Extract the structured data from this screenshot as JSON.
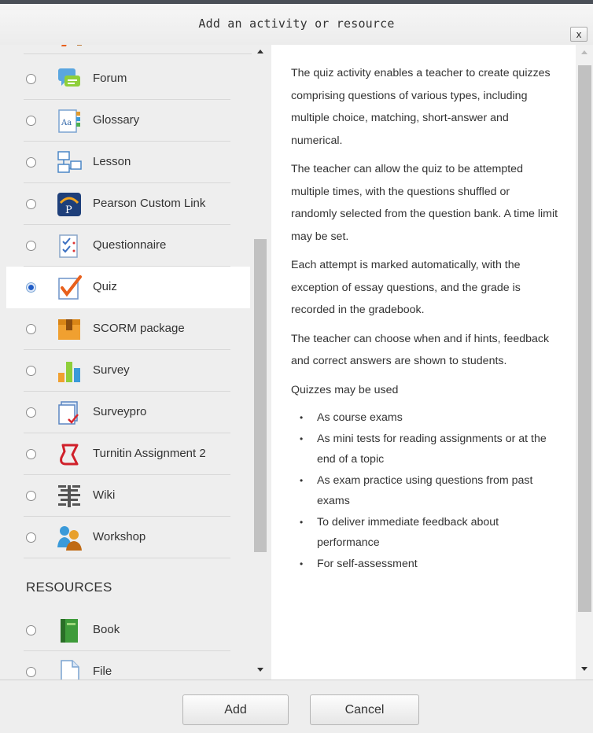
{
  "dialog": {
    "title": "Add an activity or resource",
    "close_label": "x"
  },
  "activities": [
    {
      "label": "Forum",
      "icon": "forum-icon",
      "selected": false
    },
    {
      "label": "Glossary",
      "icon": "glossary-icon",
      "selected": false
    },
    {
      "label": "Lesson",
      "icon": "lesson-icon",
      "selected": false
    },
    {
      "label": "Pearson Custom Link",
      "icon": "pearson-icon",
      "selected": false
    },
    {
      "label": "Questionnaire",
      "icon": "questionnaire-icon",
      "selected": false
    },
    {
      "label": "Quiz",
      "icon": "quiz-icon",
      "selected": true
    },
    {
      "label": "SCORM package",
      "icon": "scorm-icon",
      "selected": false
    },
    {
      "label": "Survey",
      "icon": "survey-icon",
      "selected": false
    },
    {
      "label": "Surveypro",
      "icon": "surveypro-icon",
      "selected": false
    },
    {
      "label": "Turnitin Assignment 2",
      "icon": "turnitin-icon",
      "selected": false
    },
    {
      "label": "Wiki",
      "icon": "wiki-icon",
      "selected": false
    },
    {
      "label": "Workshop",
      "icon": "workshop-icon",
      "selected": false
    }
  ],
  "resources_heading": "RESOURCES",
  "resources": [
    {
      "label": "Book",
      "icon": "book-icon",
      "selected": false
    },
    {
      "label": "File",
      "icon": "file-icon",
      "selected": false
    }
  ],
  "description": {
    "paragraphs": [
      "The quiz activity enables a teacher to create quizzes comprising questions of various types, including multiple choice, matching, short-answer and numerical.",
      "The teacher can allow the quiz to be attempted multiple times, with the questions shuffled or randomly selected from the question bank. A time limit may be set.",
      "Each attempt is marked automatically, with the exception of essay questions, and the grade is recorded in the gradebook.",
      "The teacher can choose when and if hints, feedback and correct answers are shown to students.",
      "Quizzes may be used"
    ],
    "bullets": [
      "As course exams",
      "As mini tests for reading assignments or at the end of a topic",
      "As exam practice using questions from past exams",
      "To deliver immediate feedback about performance",
      "For self-assessment"
    ]
  },
  "footer": {
    "add_label": "Add",
    "cancel_label": "Cancel"
  },
  "colors": {
    "radio_checked": "#1f5cc7",
    "panel_bg": "#eeeeee",
    "header_border": "#4a4f57"
  }
}
